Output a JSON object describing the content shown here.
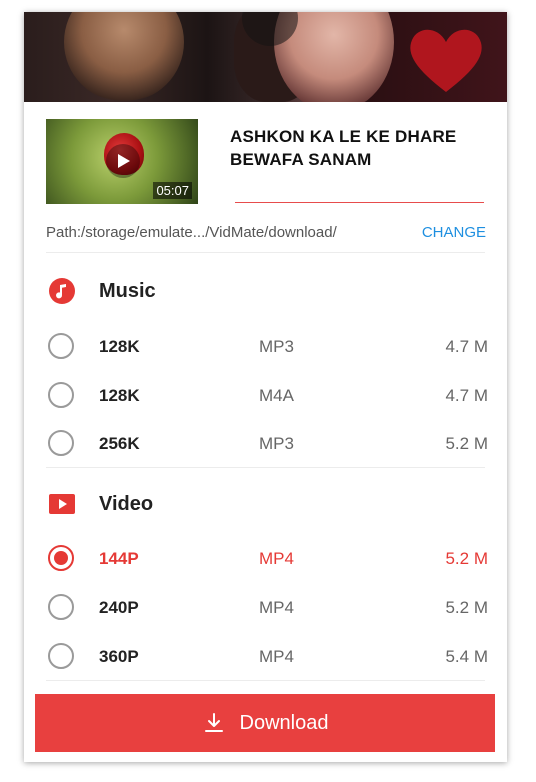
{
  "video": {
    "title_line1": "ASHKON KA LE KE DHARE",
    "title_line2": "BEWAFA SANAM",
    "duration": "05:07"
  },
  "path": {
    "text": "Path:/storage/emulate.../VidMate/download/",
    "change_label": "CHANGE"
  },
  "music": {
    "label": "Music",
    "icon": "music-note-icon",
    "options": [
      {
        "quality": "128K",
        "format": "MP3",
        "size": "4.7 M",
        "selected": false
      },
      {
        "quality": "128K",
        "format": "M4A",
        "size": "4.7 M",
        "selected": false
      },
      {
        "quality": "256K",
        "format": "MP3",
        "size": "5.2 M",
        "selected": false
      }
    ]
  },
  "video_section": {
    "label": "Video",
    "icon": "youtube-play-icon",
    "options": [
      {
        "quality": "144P",
        "format": "MP4",
        "size": "5.2 M",
        "selected": true
      },
      {
        "quality": "240P",
        "format": "MP4",
        "size": "5.2 M",
        "selected": false
      },
      {
        "quality": "360P",
        "format": "MP4",
        "size": "5.4 M",
        "selected": false
      }
    ]
  },
  "download": {
    "label": "Download",
    "icon": "download-icon"
  },
  "colors": {
    "accent": "#e8403f",
    "link": "#1e8fe0"
  }
}
